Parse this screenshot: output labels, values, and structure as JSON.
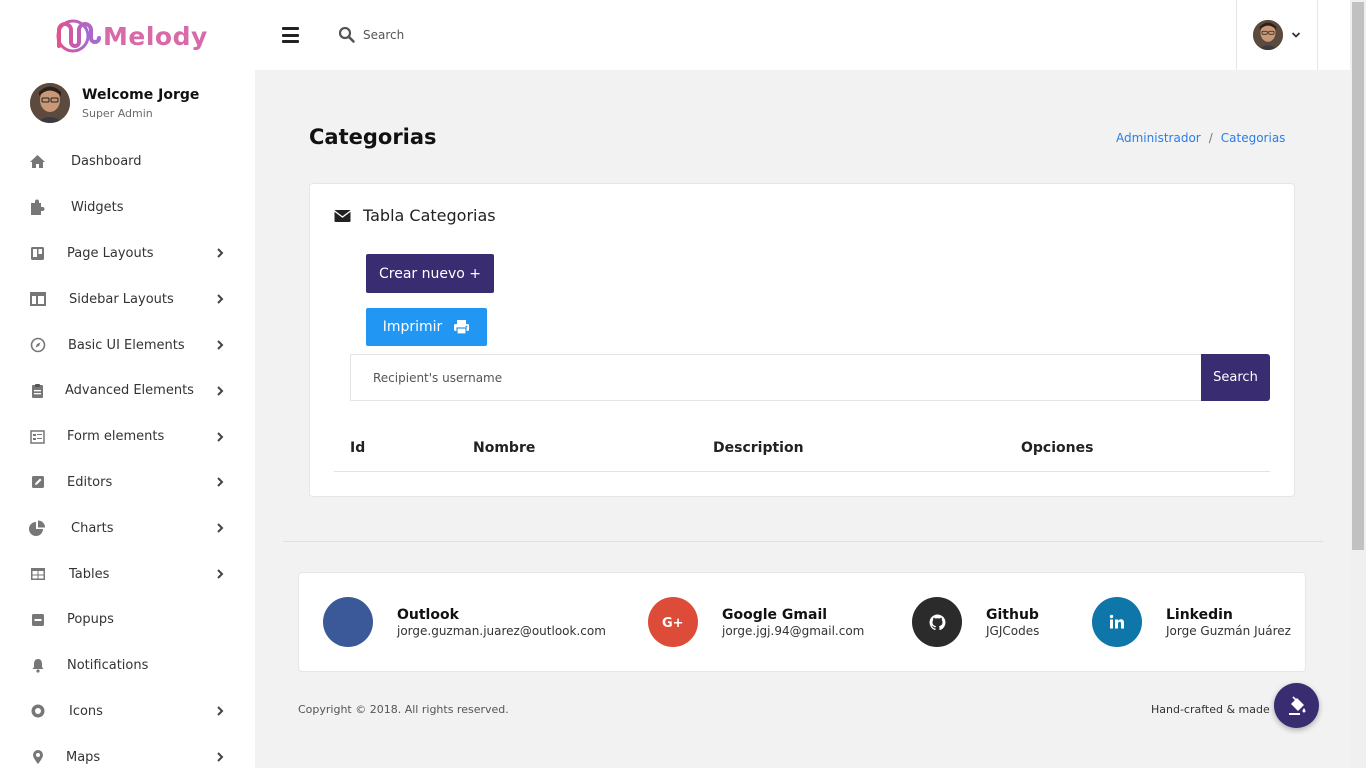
{
  "brand": {
    "name": "Melody",
    "color": "#d86aa9"
  },
  "profile": {
    "welcome": "Welcome Jorge",
    "role": "Super Admin"
  },
  "sidebar": {
    "items": [
      {
        "label": "Dashboard",
        "icon": "home-icon",
        "has_children": false
      },
      {
        "label": "Widgets",
        "icon": "puzzle-icon",
        "has_children": false
      },
      {
        "label": "Page Layouts",
        "icon": "trello-icon",
        "has_children": true
      },
      {
        "label": "Sidebar Layouts",
        "icon": "columns-icon",
        "has_children": true
      },
      {
        "label": "Basic UI Elements",
        "icon": "compass-icon",
        "has_children": true
      },
      {
        "label": "Advanced Elements",
        "icon": "clipboard-icon",
        "has_children": true
      },
      {
        "label": "Form elements",
        "icon": "form-icon",
        "has_children": true
      },
      {
        "label": "Editors",
        "icon": "edit-icon",
        "has_children": true
      },
      {
        "label": "Charts",
        "icon": "pie-chart-icon",
        "has_children": true
      },
      {
        "label": "Tables",
        "icon": "table-icon",
        "has_children": true
      },
      {
        "label": "Popups",
        "icon": "minus-square-icon",
        "has_children": false
      },
      {
        "label": "Notifications",
        "icon": "bell-icon",
        "has_children": false
      },
      {
        "label": "Icons",
        "icon": "dot-circle-icon",
        "has_children": true
      },
      {
        "label": "Maps",
        "icon": "map-marker-icon",
        "has_children": true
      }
    ]
  },
  "topbar": {
    "search_placeholder": "Search"
  },
  "page": {
    "title": "Categorias",
    "breadcrumb": [
      "Administrador",
      "Categorias"
    ]
  },
  "card": {
    "title": "Tabla Categorias",
    "create_button": "Crear nuevo +",
    "print_button": "Imprimir",
    "recipient_placeholder": "Recipient's username",
    "search_button": "Search",
    "columns": [
      "Id",
      "Nombre",
      "Description",
      "Opciones"
    ]
  },
  "contacts": [
    {
      "name": "Outlook",
      "detail": "jorge.guzman.juarez@outlook.com",
      "color": "#3b5998",
      "icon": "outlook-icon"
    },
    {
      "name": "Google Gmail",
      "detail": "jorge.jgj.94@gmail.com",
      "color": "#dd4b39",
      "icon": "google-plus-icon"
    },
    {
      "name": "Github",
      "detail": "JGJCodes",
      "color": "#2b2b2b",
      "icon": "github-icon"
    },
    {
      "name": "Linkedin",
      "detail": "Jorge Guzmán Juárez",
      "color": "#0e76a8",
      "icon": "linkedin-icon"
    }
  ],
  "footer": {
    "copyright": "Copyright © 2018. All rights reserved.",
    "handcrafted": "Hand-crafted & made w"
  },
  "colors": {
    "primary": "#392c70",
    "info": "#2196f3",
    "link": "#2b7de9"
  }
}
